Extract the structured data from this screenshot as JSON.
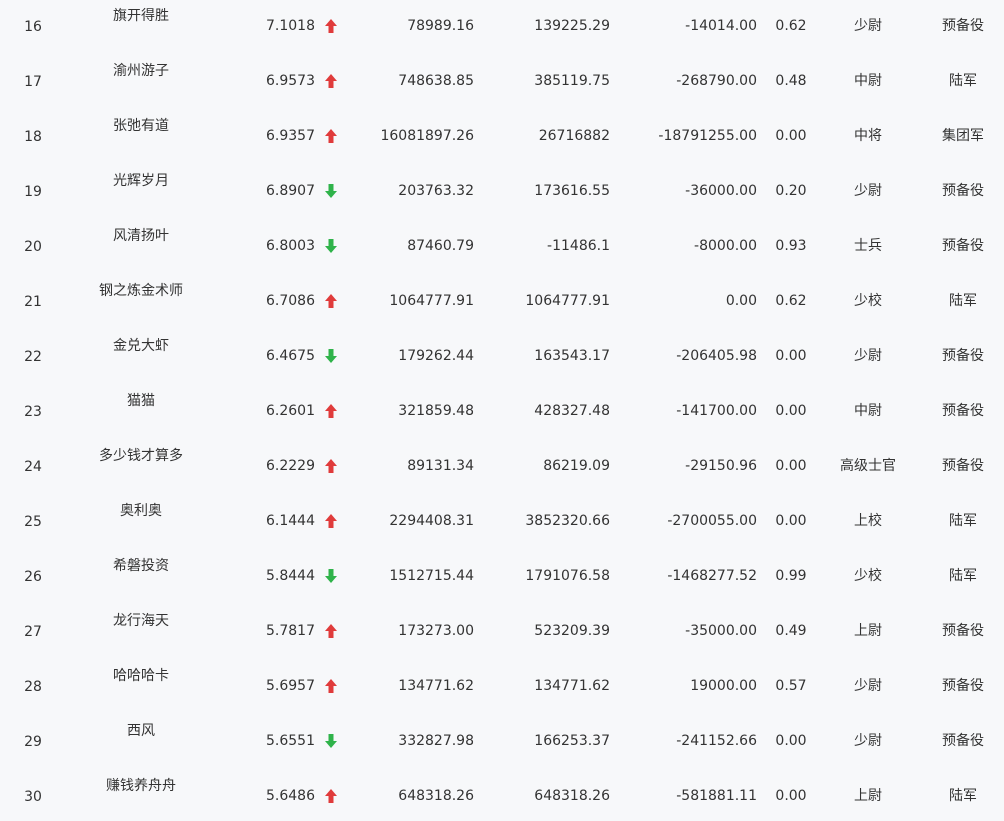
{
  "colors": {
    "up": "#e03b3b",
    "down": "#2fb34a",
    "text": "#333333",
    "background": "#f7f8fa"
  },
  "rows": [
    {
      "rank": "16",
      "name": "旗开得胜",
      "score": "7.1018",
      "trend": "up",
      "v1": "78989.16",
      "v2": "139225.29",
      "v3": "-14014.00",
      "ratio": "0.62",
      "title": "少尉",
      "branch": "预备役"
    },
    {
      "rank": "17",
      "name": "渝州游子",
      "score": "6.9573",
      "trend": "up",
      "v1": "748638.85",
      "v2": "385119.75",
      "v3": "-268790.00",
      "ratio": "0.48",
      "title": "中尉",
      "branch": "陆军"
    },
    {
      "rank": "18",
      "name": "张弛有道",
      "score": "6.9357",
      "trend": "up",
      "v1": "16081897.26",
      "v2": "26716882",
      "v3": "-18791255.00",
      "ratio": "0.00",
      "title": "中将",
      "branch": "集团军"
    },
    {
      "rank": "19",
      "name": "光辉岁月",
      "score": "6.8907",
      "trend": "down",
      "v1": "203763.32",
      "v2": "173616.55",
      "v3": "-36000.00",
      "ratio": "0.20",
      "title": "少尉",
      "branch": "预备役"
    },
    {
      "rank": "20",
      "name": "风清扬叶",
      "score": "6.8003",
      "trend": "down",
      "v1": "87460.79",
      "v2": "-11486.1",
      "v3": "-8000.00",
      "ratio": "0.93",
      "title": "士兵",
      "branch": "预备役"
    },
    {
      "rank": "21",
      "name": "钢之炼金术师",
      "score": "6.7086",
      "trend": "up",
      "v1": "1064777.91",
      "v2": "1064777.91",
      "v3": "0.00",
      "ratio": "0.62",
      "title": "少校",
      "branch": "陆军"
    },
    {
      "rank": "22",
      "name": "金兑大虾",
      "score": "6.4675",
      "trend": "down",
      "v1": "179262.44",
      "v2": "163543.17",
      "v3": "-206405.98",
      "ratio": "0.00",
      "title": "少尉",
      "branch": "预备役"
    },
    {
      "rank": "23",
      "name": "猫猫",
      "score": "6.2601",
      "trend": "up",
      "v1": "321859.48",
      "v2": "428327.48",
      "v3": "-141700.00",
      "ratio": "0.00",
      "title": "中尉",
      "branch": "预备役"
    },
    {
      "rank": "24",
      "name": "多少钱才算多",
      "score": "6.2229",
      "trend": "up",
      "v1": "89131.34",
      "v2": "86219.09",
      "v3": "-29150.96",
      "ratio": "0.00",
      "title": "高级士官",
      "branch": "预备役"
    },
    {
      "rank": "25",
      "name": "奥利奥",
      "score": "6.1444",
      "trend": "up",
      "v1": "2294408.31",
      "v2": "3852320.66",
      "v3": "-2700055.00",
      "ratio": "0.00",
      "title": "上校",
      "branch": "陆军"
    },
    {
      "rank": "26",
      "name": "希磐投资",
      "score": "5.8444",
      "trend": "down",
      "v1": "1512715.44",
      "v2": "1791076.58",
      "v3": "-1468277.52",
      "ratio": "0.99",
      "title": "少校",
      "branch": "陆军"
    },
    {
      "rank": "27",
      "name": "龙行海天",
      "score": "5.7817",
      "trend": "up",
      "v1": "173273.00",
      "v2": "523209.39",
      "v3": "-35000.00",
      "ratio": "0.49",
      "title": "上尉",
      "branch": "预备役"
    },
    {
      "rank": "28",
      "name": "哈哈哈卡",
      "score": "5.6957",
      "trend": "up",
      "v1": "134771.62",
      "v2": "134771.62",
      "v3": "19000.00",
      "ratio": "0.57",
      "title": "少尉",
      "branch": "预备役"
    },
    {
      "rank": "29",
      "name": "西风",
      "score": "5.6551",
      "trend": "down",
      "v1": "332827.98",
      "v2": "166253.37",
      "v3": "-241152.66",
      "ratio": "0.00",
      "title": "少尉",
      "branch": "预备役"
    },
    {
      "rank": "30",
      "name": "赚钱养舟舟",
      "score": "5.6486",
      "trend": "up",
      "v1": "648318.26",
      "v2": "648318.26",
      "v3": "-581881.11",
      "ratio": "0.00",
      "title": "上尉",
      "branch": "陆军"
    }
  ]
}
